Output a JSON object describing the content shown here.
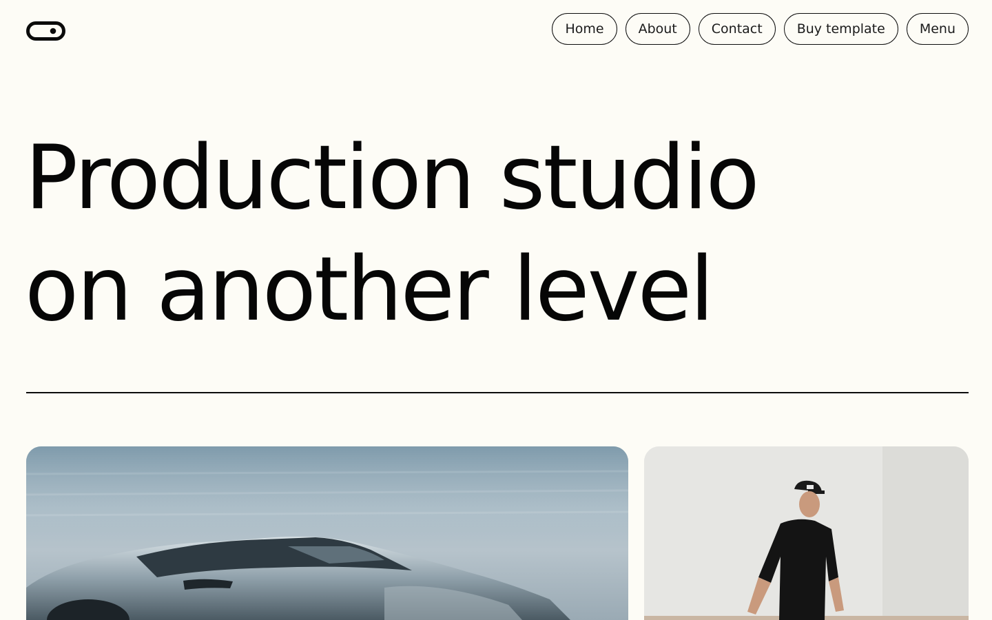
{
  "header": {
    "logo_icon": "pill-toggle-logo-icon",
    "nav": [
      {
        "label": "Home"
      },
      {
        "label": "About"
      },
      {
        "label": "Contact"
      },
      {
        "label": "Buy template"
      },
      {
        "label": "Menu"
      }
    ]
  },
  "hero": {
    "title_line_1": "Production studio",
    "title_line_2": "on another level"
  },
  "gallery": {
    "items": [
      {
        "image": "silver-sports-car-photo"
      },
      {
        "image": "man-in-black-cap-walking-photo"
      }
    ]
  },
  "colors": {
    "background": "#fdfcf6",
    "text": "#0b0b0b",
    "border": "#0b0b0b"
  }
}
